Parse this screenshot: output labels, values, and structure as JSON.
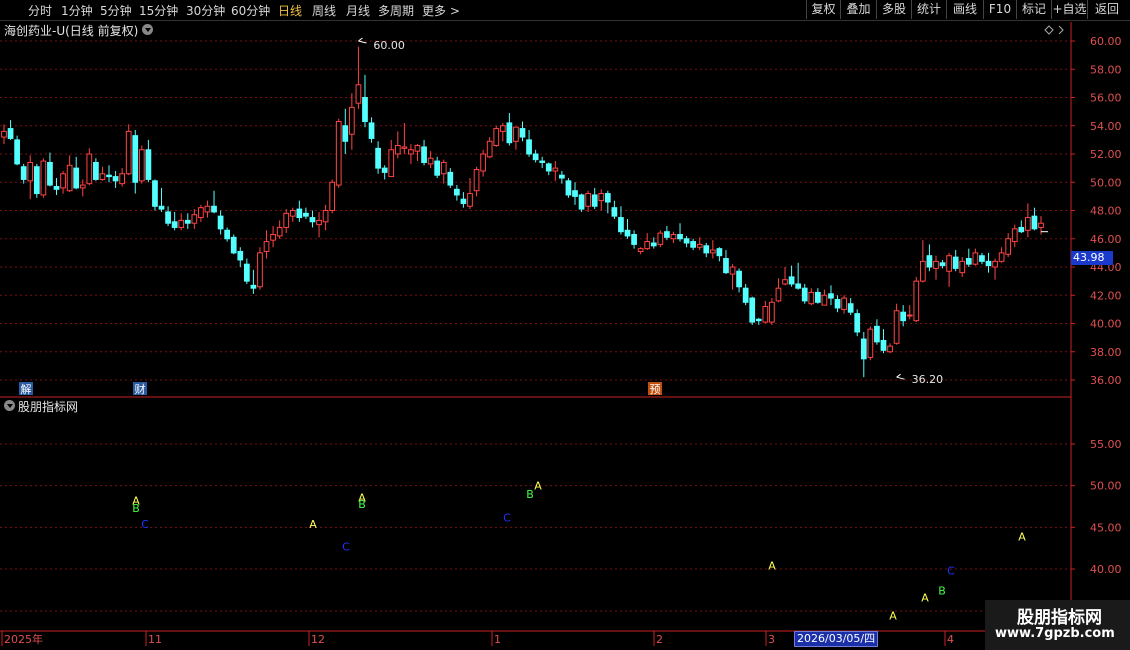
{
  "toolbar": {
    "timeframes": [
      {
        "label": "分时",
        "active": false
      },
      {
        "label": "1分钟",
        "active": false
      },
      {
        "label": "5分钟",
        "active": false
      },
      {
        "label": "15分钟",
        "active": false
      },
      {
        "label": "30分钟",
        "active": false
      },
      {
        "label": "60分钟",
        "active": false
      },
      {
        "label": "日线",
        "active": true
      },
      {
        "label": "周线",
        "active": false
      },
      {
        "label": "月线",
        "active": false
      },
      {
        "label": "多周期",
        "active": false
      },
      {
        "label": "更多 >",
        "active": false
      }
    ],
    "buttons": [
      "复权",
      "叠加",
      "多股",
      "统计",
      "画线",
      "F10",
      "标记",
      "+自选",
      "返回"
    ]
  },
  "stock_title": "海创药业-U(日线 前复权)",
  "indicator_title": "股朋指标网",
  "price_tag": "43.98",
  "date_tag": "2026/03/05/四",
  "watermark": {
    "cn": "股朋指标网",
    "url": "www.7gpzb.com"
  },
  "colors": {
    "up": "#ff4444",
    "down": "#54ffff",
    "grid": "#7a1010",
    "axis": "#cc2222"
  },
  "chart_data": [
    {
      "type": "candlestick",
      "title": "海创药业-U(日线 前复权)",
      "y_ticks": [
        36,
        38,
        40,
        42,
        44,
        46,
        48,
        50,
        52,
        54,
        56,
        58,
        60
      ],
      "ylim": [
        35.2,
        61.2
      ],
      "annotations": [
        {
          "label": "60.00",
          "value": 60.0
        },
        {
          "label": "36.20",
          "value": 36.2
        }
      ],
      "events": [
        {
          "label": "解"
        },
        {
          "label": "财"
        },
        {
          "label": "预"
        }
      ],
      "x_labels": [
        "2025年",
        "11",
        "12",
        "1",
        "2",
        "3",
        "4"
      ],
      "ohlc": [
        [
          53.2,
          54.1,
          52.7,
          53.6
        ],
        [
          53.8,
          54.4,
          53.0,
          53.1
        ],
        [
          53.0,
          53.3,
          51.2,
          51.3
        ],
        [
          51.1,
          51.3,
          49.9,
          50.2
        ],
        [
          50.1,
          51.9,
          48.8,
          51.4
        ],
        [
          51.1,
          51.3,
          48.9,
          49.2
        ],
        [
          49.1,
          51.7,
          48.9,
          51.5
        ],
        [
          51.4,
          52.1,
          49.7,
          49.8
        ],
        [
          49.7,
          50.3,
          49.1,
          49.5
        ],
        [
          49.6,
          50.8,
          49.2,
          50.6
        ],
        [
          49.4,
          51.9,
          49.3,
          51.2
        ],
        [
          51.0,
          51.8,
          49.5,
          49.6
        ],
        [
          49.6,
          50.2,
          49.0,
          49.8
        ],
        [
          49.9,
          52.4,
          49.8,
          52.0
        ],
        [
          51.4,
          51.7,
          50.1,
          50.2
        ],
        [
          50.2,
          51.1,
          50.1,
          50.6
        ],
        [
          50.5,
          51.2,
          50.0,
          50.4
        ],
        [
          50.4,
          50.8,
          49.6,
          50.1
        ],
        [
          49.9,
          51.0,
          49.7,
          50.6
        ],
        [
          50.6,
          54.1,
          50.5,
          53.6
        ],
        [
          53.3,
          53.7,
          49.2,
          50.0
        ],
        [
          50.1,
          52.6,
          49.9,
          52.3
        ],
        [
          52.3,
          53.0,
          50.0,
          50.2
        ],
        [
          50.1,
          50.2,
          48.0,
          48.3
        ],
        [
          48.3,
          49.6,
          47.9,
          48.1
        ],
        [
          47.9,
          48.3,
          46.9,
          47.1
        ],
        [
          47.2,
          47.9,
          46.6,
          46.8
        ],
        [
          46.8,
          47.8,
          46.6,
          47.3
        ],
        [
          47.3,
          47.8,
          46.7,
          47.1
        ],
        [
          47.1,
          48.1,
          46.7,
          47.7
        ],
        [
          47.5,
          48.4,
          47.2,
          48.2
        ],
        [
          47.9,
          48.7,
          47.5,
          48.3
        ],
        [
          48.3,
          49.4,
          47.8,
          47.9
        ],
        [
          47.6,
          48.0,
          46.3,
          46.7
        ],
        [
          46.6,
          46.8,
          45.8,
          46.0
        ],
        [
          46.1,
          46.3,
          44.9,
          45.0
        ],
        [
          45.1,
          45.4,
          44.0,
          44.5
        ],
        [
          44.2,
          44.6,
          42.8,
          43.0
        ],
        [
          42.7,
          43.8,
          42.1,
          42.5
        ],
        [
          42.6,
          45.4,
          42.4,
          45.0
        ],
        [
          45.1,
          46.6,
          44.6,
          45.8
        ],
        [
          45.9,
          46.9,
          45.4,
          46.3
        ],
        [
          46.2,
          47.3,
          46.0,
          46.8
        ],
        [
          46.8,
          48.1,
          46.4,
          47.8
        ],
        [
          47.6,
          48.2,
          47.2,
          48.0
        ],
        [
          48.1,
          48.7,
          47.2,
          47.5
        ],
        [
          47.8,
          48.2,
          47.4,
          47.6
        ],
        [
          47.5,
          48.0,
          46.8,
          47.2
        ],
        [
          47.0,
          47.9,
          46.1,
          47.3
        ],
        [
          47.2,
          48.4,
          46.6,
          48.0
        ],
        [
          48.0,
          50.2,
          47.8,
          50.0
        ],
        [
          49.8,
          54.5,
          49.6,
          54.3
        ],
        [
          54.0,
          55.2,
          52.0,
          52.9
        ],
        [
          53.4,
          56.3,
          52.3,
          55.3
        ],
        [
          55.6,
          59.6,
          55.2,
          56.9
        ],
        [
          56.0,
          57.6,
          53.9,
          54.3
        ],
        [
          54.2,
          54.6,
          52.8,
          53.1
        ],
        [
          52.4,
          52.9,
          50.6,
          51.0
        ],
        [
          51.0,
          51.2,
          50.2,
          50.7
        ],
        [
          50.4,
          53.0,
          50.5,
          52.3
        ],
        [
          52.0,
          53.6,
          51.7,
          52.6
        ],
        [
          52.4,
          54.2,
          52.0,
          52.5
        ],
        [
          52.0,
          52.7,
          51.3,
          52.3
        ],
        [
          52.2,
          52.7,
          51.5,
          52.6
        ],
        [
          52.5,
          53.0,
          51.2,
          51.4
        ],
        [
          51.3,
          52.2,
          51.0,
          51.7
        ],
        [
          51.5,
          51.8,
          50.3,
          50.5
        ],
        [
          50.6,
          51.6,
          49.9,
          51.4
        ],
        [
          50.7,
          51.0,
          49.6,
          49.8
        ],
        [
          49.5,
          49.8,
          48.7,
          49.1
        ],
        [
          48.8,
          49.3,
          48.2,
          48.5
        ],
        [
          48.3,
          50.3,
          48.1,
          49.2
        ],
        [
          49.4,
          51.1,
          49.0,
          50.9
        ],
        [
          50.8,
          52.3,
          50.4,
          52.0
        ],
        [
          51.8,
          53.2,
          51.7,
          52.9
        ],
        [
          52.6,
          54.0,
          52.5,
          53.8
        ],
        [
          53.6,
          54.2,
          52.9,
          54.0
        ],
        [
          54.2,
          54.9,
          52.6,
          52.8
        ],
        [
          52.9,
          53.1,
          52.3,
          53.9
        ],
        [
          53.8,
          54.3,
          52.9,
          53.2
        ],
        [
          53.0,
          53.7,
          51.8,
          52.0
        ],
        [
          52.0,
          52.3,
          51.4,
          51.6
        ],
        [
          51.5,
          51.8,
          51.0,
          51.4
        ],
        [
          51.3,
          51.4,
          50.5,
          50.8
        ],
        [
          50.8,
          51.5,
          50.1,
          51.0
        ],
        [
          50.5,
          50.8,
          49.9,
          50.3
        ],
        [
          50.1,
          50.3,
          48.9,
          49.1
        ],
        [
          49.4,
          50.0,
          48.4,
          49.0
        ],
        [
          49.1,
          49.2,
          47.9,
          48.1
        ],
        [
          48.3,
          49.4,
          47.9,
          49.2
        ],
        [
          49.1,
          49.6,
          48.1,
          48.3
        ],
        [
          48.7,
          49.5,
          48.0,
          49.2
        ],
        [
          49.2,
          49.4,
          47.8,
          48.6
        ],
        [
          48.2,
          48.7,
          47.4,
          47.6
        ],
        [
          47.5,
          48.3,
          46.3,
          46.5
        ],
        [
          46.6,
          47.4,
          46.0,
          46.2
        ],
        [
          46.3,
          46.6,
          45.3,
          45.6
        ],
        [
          45.1,
          45.4,
          44.9,
          45.3
        ],
        [
          45.3,
          46.4,
          45.2,
          45.8
        ],
        [
          45.7,
          46.1,
          45.3,
          45.5
        ],
        [
          45.6,
          46.6,
          45.4,
          46.4
        ],
        [
          46.5,
          46.9,
          45.9,
          46.1
        ],
        [
          46.0,
          46.5,
          45.7,
          46.3
        ],
        [
          46.3,
          47.1,
          45.8,
          46.0
        ],
        [
          46.0,
          46.2,
          45.4,
          45.7
        ],
        [
          45.8,
          46.0,
          45.2,
          45.4
        ],
        [
          45.4,
          46.1,
          45.2,
          45.6
        ],
        [
          45.5,
          45.7,
          44.7,
          45.0
        ],
        [
          45.0,
          45.9,
          44.6,
          45.2
        ],
        [
          45.3,
          45.4,
          44.4,
          44.8
        ],
        [
          44.6,
          45.2,
          43.5,
          43.6
        ],
        [
          43.5,
          44.2,
          42.4,
          44.0
        ],
        [
          43.7,
          43.9,
          42.2,
          42.6
        ],
        [
          42.5,
          42.8,
          41.3,
          41.5
        ],
        [
          41.8,
          41.9,
          39.9,
          40.1
        ],
        [
          40.3,
          40.4,
          39.9,
          40.2
        ],
        [
          40.1,
          41.6,
          40.0,
          41.2
        ],
        [
          40.1,
          41.8,
          39.9,
          41.5
        ],
        [
          41.6,
          43.2,
          41.5,
          42.5
        ],
        [
          42.8,
          44.0,
          42.7,
          43.1
        ],
        [
          43.3,
          44.1,
          42.6,
          42.8
        ],
        [
          42.8,
          44.3,
          42.4,
          42.5
        ],
        [
          42.5,
          42.8,
          41.4,
          41.6
        ],
        [
          41.4,
          42.5,
          41.3,
          42.2
        ],
        [
          42.2,
          42.5,
          41.4,
          41.5
        ],
        [
          41.3,
          42.4,
          41.4,
          42.0
        ],
        [
          42.1,
          42.7,
          41.3,
          41.8
        ],
        [
          41.7,
          42.0,
          40.8,
          41.1
        ],
        [
          41.0,
          42.0,
          40.7,
          41.8
        ],
        [
          41.4,
          41.8,
          40.6,
          40.8
        ],
        [
          40.7,
          41.0,
          39.1,
          39.4
        ],
        [
          38.9,
          39.4,
          36.2,
          37.5
        ],
        [
          37.6,
          39.8,
          37.4,
          39.6
        ],
        [
          39.8,
          40.3,
          38.5,
          38.7
        ],
        [
          38.8,
          39.6,
          37.9,
          38.1
        ],
        [
          38.0,
          38.6,
          37.9,
          38.4
        ],
        [
          38.6,
          41.4,
          38.5,
          40.9
        ],
        [
          40.8,
          41.3,
          39.8,
          40.2
        ],
        [
          40.6,
          41.3,
          40.3,
          40.6
        ],
        [
          40.2,
          43.3,
          40.1,
          43.0
        ],
        [
          43.0,
          45.9,
          42.9,
          44.4
        ],
        [
          44.8,
          45.6,
          43.7,
          44.0
        ],
        [
          43.9,
          44.8,
          43.1,
          44.4
        ],
        [
          44.3,
          44.5,
          43.9,
          44.1
        ],
        [
          43.7,
          45.0,
          42.6,
          44.8
        ],
        [
          44.7,
          45.2,
          43.7,
          43.9
        ],
        [
          43.6,
          44.7,
          43.3,
          44.4
        ],
        [
          44.6,
          45.3,
          44.0,
          44.2
        ],
        [
          44.2,
          45.3,
          44.1,
          45.0
        ],
        [
          44.8,
          45.0,
          44.2,
          44.4
        ],
        [
          44.4,
          45.0,
          43.6,
          44.1
        ],
        [
          44.0,
          44.6,
          43.1,
          44.4
        ],
        [
          44.4,
          45.4,
          44.3,
          45.0
        ],
        [
          44.9,
          46.4,
          44.7,
          46.0
        ],
        [
          45.8,
          47.0,
          45.4,
          46.7
        ],
        [
          46.8,
          47.3,
          46.4,
          46.5
        ],
        [
          46.6,
          48.5,
          46.1,
          47.5
        ],
        [
          47.6,
          48.2,
          46.6,
          46.7
        ],
        [
          46.8,
          47.6,
          46.3,
          47.1
        ]
      ]
    },
    {
      "type": "scatter",
      "title": "股朋指标网",
      "y_ticks": [
        40,
        45,
        50,
        55
      ],
      "ylim": [
        32.2,
        59.5
      ],
      "markers": [
        {
          "label": "A",
          "value": 48.2,
          "color": "#ffff55"
        },
        {
          "label": "B",
          "value": 47.3,
          "color": "#44ff44"
        },
        {
          "label": "C",
          "value": 45.4,
          "color": "#2233ff"
        },
        {
          "label": "A",
          "value": 45.4,
          "color": "#ffff55"
        },
        {
          "label": "C",
          "value": 42.7,
          "color": "#2233ff"
        },
        {
          "label": "A",
          "value": 48.6,
          "color": "#ffff55"
        },
        {
          "label": "B",
          "value": 47.8,
          "color": "#44ff44"
        },
        {
          "label": "C",
          "value": 46.2,
          "color": "#2233ff"
        },
        {
          "label": "B",
          "value": 49.0,
          "color": "#44ff44"
        },
        {
          "label": "A",
          "value": 50.0,
          "color": "#ffff55"
        },
        {
          "label": "A",
          "value": 40.4,
          "color": "#ffff55"
        },
        {
          "label": "A",
          "value": 34.4,
          "color": "#ffff55"
        },
        {
          "label": "A",
          "value": 36.6,
          "color": "#ffff55"
        },
        {
          "label": "B",
          "value": 37.4,
          "color": "#44ff44"
        },
        {
          "label": "C",
          "value": 39.8,
          "color": "#2233ff"
        },
        {
          "label": "A",
          "value": 43.9,
          "color": "#ffff55"
        }
      ]
    }
  ]
}
